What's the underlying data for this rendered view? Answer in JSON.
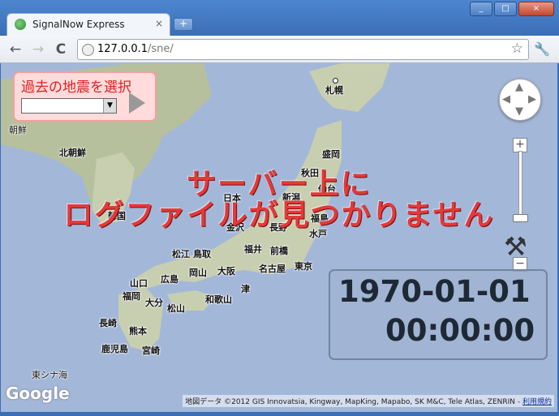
{
  "window": {
    "tab_title": "SignalNow Express",
    "tab_close": "×",
    "new_tab": "+",
    "minimize": "_",
    "maximize": "□",
    "close": "×"
  },
  "toolbar": {
    "back": "←",
    "forward": "→",
    "reload": "C",
    "url_host": "127.0.0.1",
    "url_path": "/sne/",
    "bookmark_star": "☆",
    "menu": "🔧"
  },
  "select_panel": {
    "title": "過去の地震を選択",
    "selected_value": "",
    "arrow": "▼"
  },
  "message": {
    "line1": "サーバー上に",
    "line2": "ログファイルが見つかりません"
  },
  "map_controls": {
    "pan_up": "▲",
    "pan_down": "▼",
    "pan_left": "◀",
    "pan_right": "▶",
    "zoom_in": "+",
    "zoom_out": "−",
    "tools": "⚒"
  },
  "datetime": {
    "date": "1970-01-01",
    "time": "00:00:00"
  },
  "map": {
    "logo": "Google",
    "attribution": "地図データ ©2012 GIS Innovatsia, Kingway, MapKing, Mapabo, SK M&C, Tele Atlas, ZENRIN - ",
    "terms": "利用規約",
    "cities": [
      "札幌",
      "盛岡",
      "秋田",
      "仙台",
      "新潟",
      "日本",
      "福島",
      "金沢",
      "長野",
      "水戸",
      "福井",
      "前橋",
      "東京",
      "名古屋",
      "松江",
      "鳥取",
      "岡山",
      "大阪",
      "広島",
      "山口",
      "津",
      "福岡",
      "大分",
      "松山",
      "和歌山",
      "長崎",
      "熊本",
      "鹿児島",
      "宮崎",
      "東シナ海",
      "朝鮮",
      "北朝鮮",
      "韓国"
    ]
  }
}
